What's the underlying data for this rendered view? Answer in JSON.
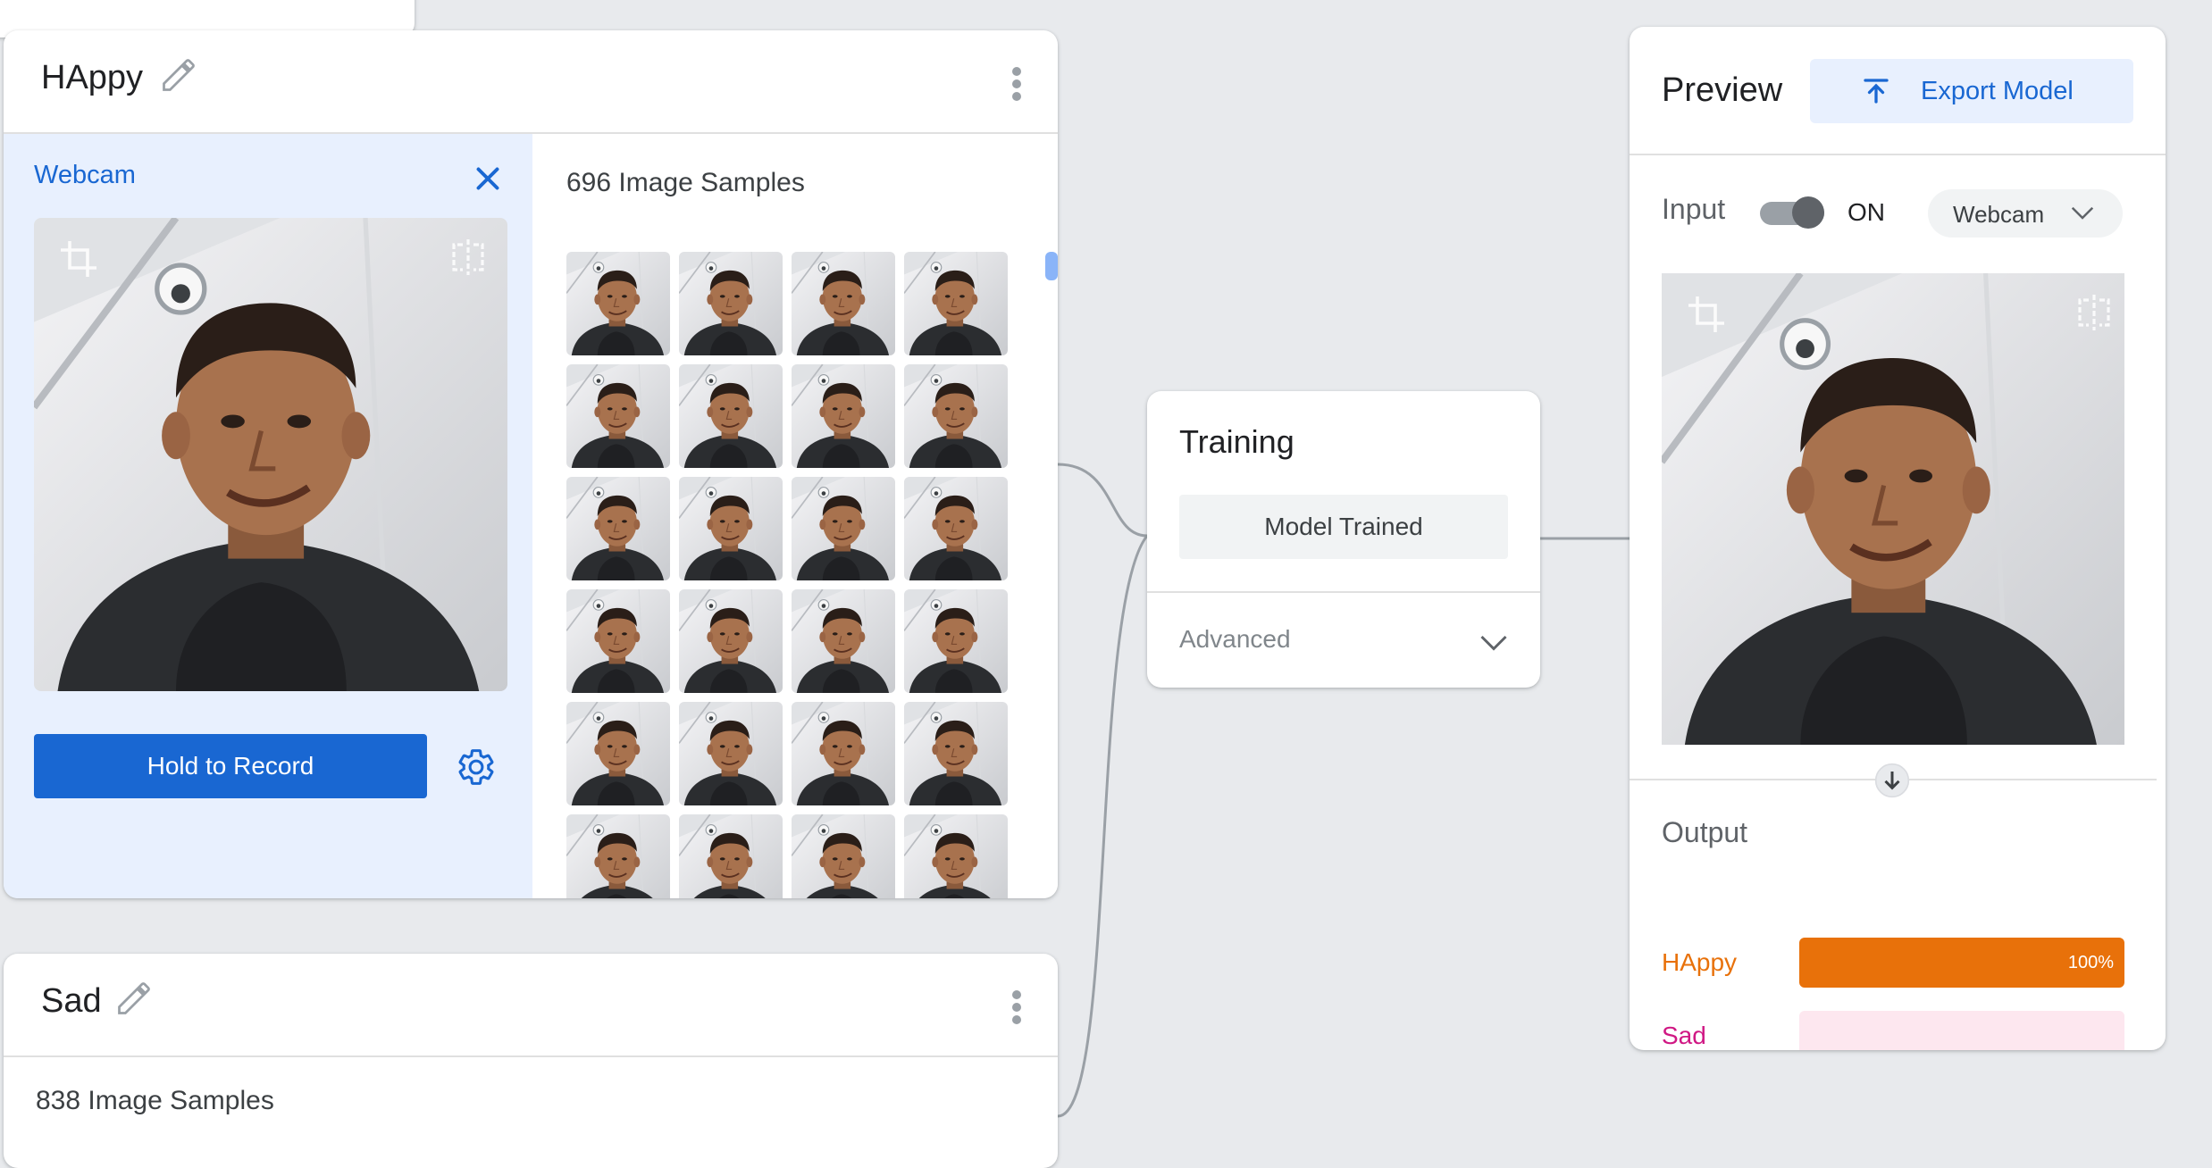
{
  "classes": [
    {
      "name": "HAppy",
      "samples_text": "696 Image Samples",
      "webcam_label": "Webcam",
      "record_label": "Hold to Record",
      "thumbnail_count": 24
    },
    {
      "name": "Sad",
      "samples_text": "838 Image Samples"
    }
  ],
  "training": {
    "title": "Training",
    "status_button": "Model Trained",
    "advanced_label": "Advanced"
  },
  "preview": {
    "title": "Preview",
    "export_label": "Export Model",
    "input_label": "Input",
    "toggle_state": "ON",
    "input_source": "Webcam",
    "output_label": "Output",
    "outputs": [
      {
        "label": "HAppy",
        "confidence": 1.0,
        "confidence_text": "100%",
        "color": "#e8710a",
        "track_color": "#fce8e6"
      },
      {
        "label": "Sad",
        "confidence": 0.0,
        "confidence_text": "",
        "color": "#d01884",
        "track_color": "#fde7ef"
      }
    ]
  },
  "colors": {
    "accent": "#1967d2",
    "happy": "#e8710a",
    "sad": "#d01884",
    "webcam_pane": "#e8f0fe"
  },
  "icons": [
    "pencil-icon",
    "kebab-icon",
    "close-icon",
    "crop-icon",
    "flip-icon",
    "gear-icon",
    "export-icon",
    "chevron-down-icon",
    "arrow-down-icon"
  ]
}
